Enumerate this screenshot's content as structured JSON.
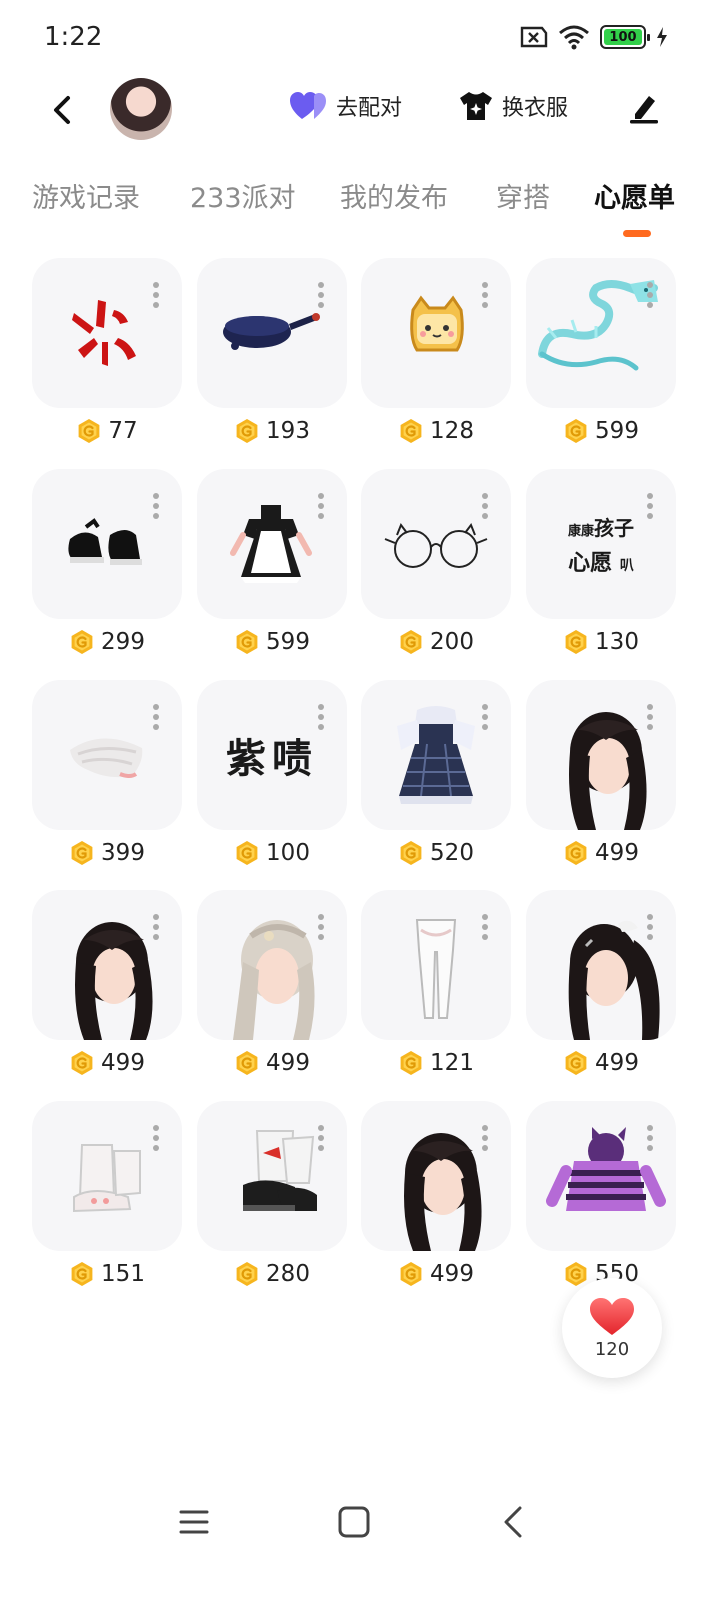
{
  "status_bar": {
    "time": "1:22",
    "battery": "100"
  },
  "header": {
    "pair_label": "去配对",
    "dress_label": "换衣服"
  },
  "tabs": [
    {
      "label": "游戏记录"
    },
    {
      "label": "233派对"
    },
    {
      "label": "我的发布"
    },
    {
      "label": "穿搭"
    },
    {
      "label": "心愿单",
      "active": true
    }
  ],
  "wishlist": [
    {
      "icon": "anger-mark",
      "price": "77"
    },
    {
      "icon": "frying-pan",
      "price": "193"
    },
    {
      "icon": "toast-cat",
      "price": "128"
    },
    {
      "icon": "ice-dragon",
      "price": "599"
    },
    {
      "icon": "black-shoes",
      "price": "299"
    },
    {
      "icon": "maid-dress",
      "price": "599"
    },
    {
      "icon": "cat-glasses",
      "price": "200"
    },
    {
      "icon": "text-sticker",
      "price": "130",
      "sticker_small": "康康",
      "sticker_big": "孩子",
      "sticker_line2": "心愿",
      "sticker_tail": "叭"
    },
    {
      "icon": "white-wing",
      "price": "399"
    },
    {
      "icon": "text-sticker",
      "price": "100",
      "sticker_big": "紫啧"
    },
    {
      "icon": "plaid-dress",
      "price": "520"
    },
    {
      "icon": "black-hair",
      "price": "499"
    },
    {
      "icon": "black-hair",
      "price": "499"
    },
    {
      "icon": "blonde-hair",
      "price": "499"
    },
    {
      "icon": "white-tights",
      "price": "121"
    },
    {
      "icon": "ponytail-hair",
      "price": "499"
    },
    {
      "icon": "slipper-boots",
      "price": "151"
    },
    {
      "icon": "platform-boots",
      "price": "280"
    },
    {
      "icon": "black-hair",
      "price": "499"
    },
    {
      "icon": "purple-hoodie",
      "price": "550"
    }
  ],
  "favorite_count": "120",
  "colors": {
    "accent": "#ff6a1f",
    "coin": "#f6b51e",
    "heart": "#f03a3a",
    "card_bg": "#f6f6f8"
  }
}
